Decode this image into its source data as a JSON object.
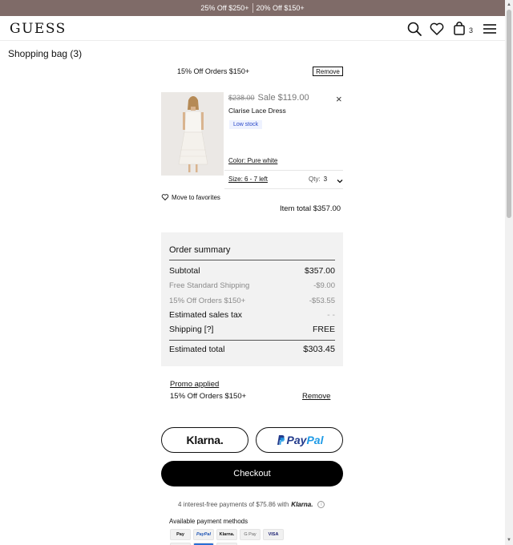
{
  "promo_bar": {
    "items": [
      "25% Off $250+",
      "20% Off $150+"
    ]
  },
  "header": {
    "logo": "GUESS",
    "cart_count": "3",
    "icons": [
      "search-icon",
      "heart-icon",
      "bag-icon",
      "menu-icon"
    ]
  },
  "page": {
    "title": "Shopping bag (3)"
  },
  "cart_promo": {
    "label": "15% Off Orders $150+",
    "remove_label": "Remove"
  },
  "item": {
    "original_price": "$238.00",
    "sale_price": "Sale $119.00",
    "name": "Clarise Lace Dress",
    "stock_badge": "Low stock",
    "color": "Color: Pure white",
    "size": "Size: 6 - 7 left",
    "qty_label": "Qty:",
    "qty_value": "3",
    "favorites_label": "Move to favorites",
    "item_total_label": "Item total",
    "item_total_value": "$357.00"
  },
  "summary": {
    "title": "Order summary",
    "rows": [
      {
        "label": "Subtotal",
        "value": "$357.00"
      },
      {
        "label": "Free Standard Shipping",
        "value": "-$9.00"
      },
      {
        "label": "15% Off Orders $150+",
        "value": "-$53.55"
      },
      {
        "label": "Estimated sales tax",
        "value": "- -"
      },
      {
        "label": "Shipping [?]",
        "value": "FREE"
      }
    ],
    "total_label": "Estimated total",
    "total_value": "$303.45"
  },
  "promo_applied": {
    "title": "Promo applied",
    "name": "15% Off Orders $150+",
    "remove_label": "Remove"
  },
  "payments": {
    "klarna_label": "Klarna.",
    "paypal_part1": "Pay",
    "paypal_part2": "Pal",
    "checkout_label": "Checkout",
    "klarna_note": "4 interest-free payments of $75.86 with",
    "klarna_note_brand": "Klarna.",
    "available_label": "Available payment methods",
    "methods": [
      "Pay",
      "PayPal",
      "Klarna.",
      "G Pay",
      "VISA"
    ]
  },
  "colors": {
    "promo_bar_bg": "#7f6b68",
    "checkout_bg": "#000000",
    "summary_bg": "#f2f2f2",
    "stock_badge_text": "#2b49c9",
    "paypal_dark": "#233b8c",
    "paypal_light": "#1f9be6"
  }
}
